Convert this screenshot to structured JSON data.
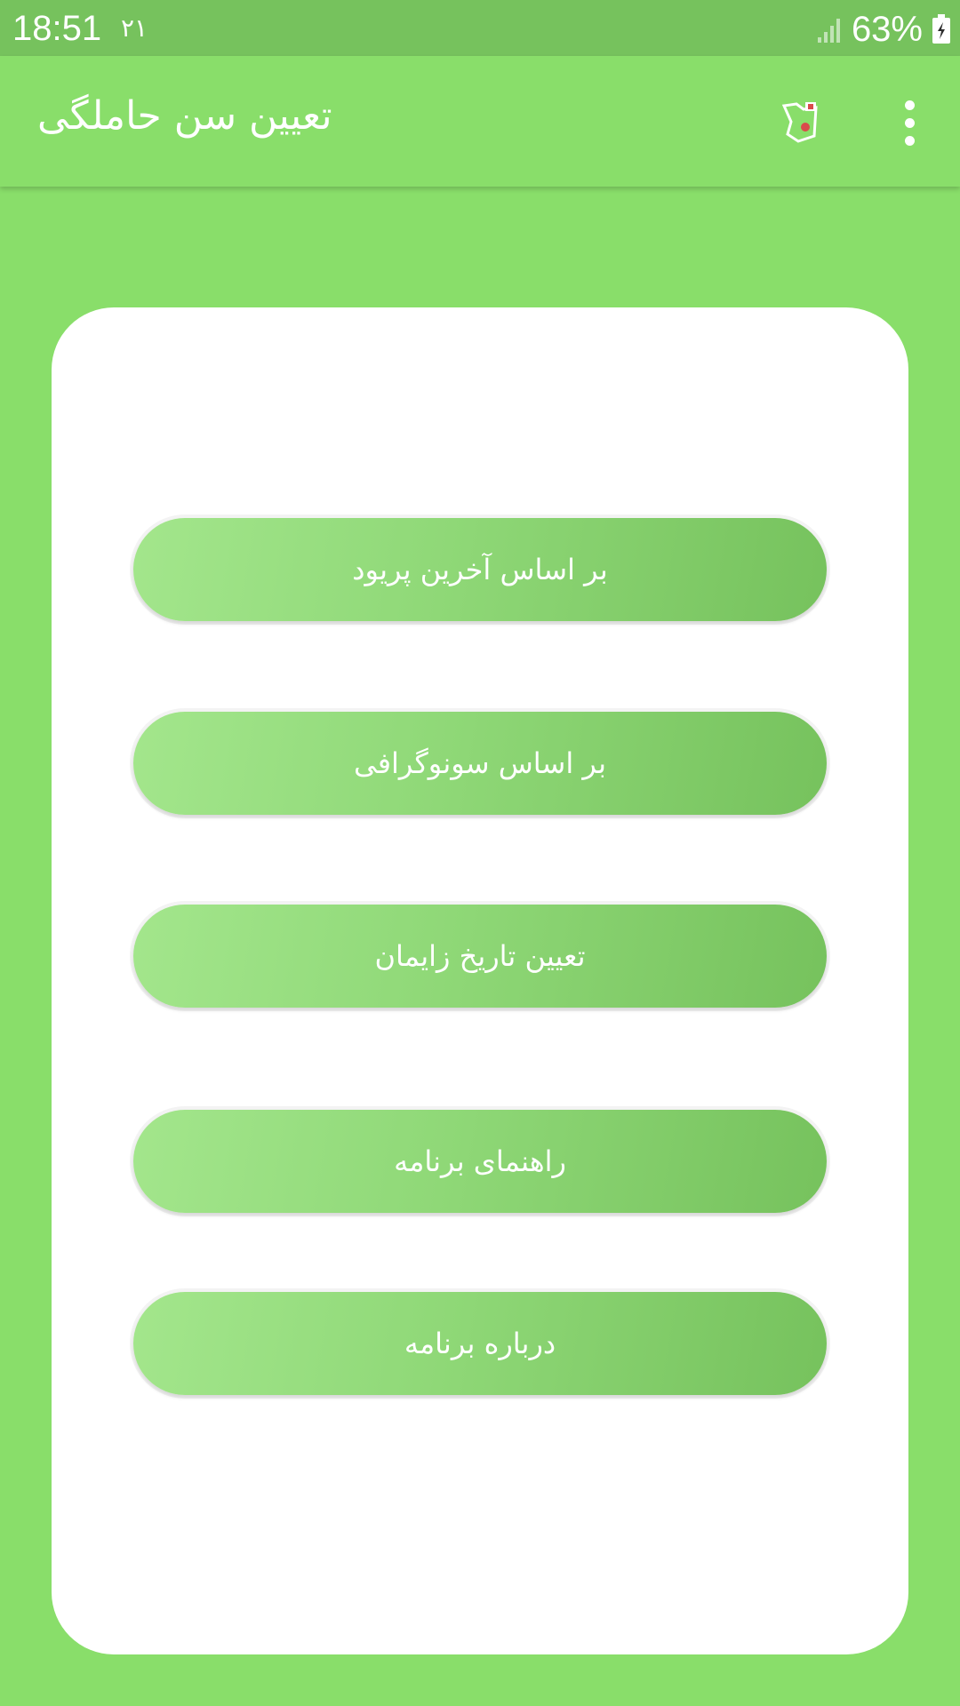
{
  "status_bar": {
    "time": "18:51",
    "notification": "۲۱",
    "battery": "63%"
  },
  "app_bar": {
    "title": "تعیین سن حاملگی"
  },
  "menu": {
    "buttons": [
      {
        "label": "بر اساس آخرین پریود"
      },
      {
        "label": "بر اساس سونوگرافی"
      },
      {
        "label": "تعیین تاریخ زایمان"
      },
      {
        "label": "راهنمای برنامه"
      },
      {
        "label": "درباره برنامه"
      }
    ]
  },
  "colors": {
    "background": "#89de6a",
    "status_bar": "#76c25d",
    "card": "#ffffff",
    "button_start": "#a3e68c",
    "button_end": "#76c25d"
  },
  "icons": [
    "signal-icon",
    "battery-icon",
    "app-logo-icon",
    "more-vert-icon"
  ]
}
